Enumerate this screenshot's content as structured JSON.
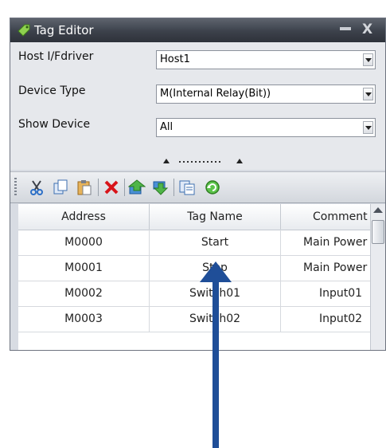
{
  "window": {
    "title": "Tag Editor",
    "minimize_icon": "minimize-icon",
    "close_label": "X"
  },
  "form": {
    "host_label": "Host I/Fdriver",
    "host_value": "Host1",
    "device_type_label": "Device Type",
    "device_type_value": "M(Internal Relay(Bit))",
    "show_device_label": "Show Device",
    "show_device_value": "All"
  },
  "toolbar": {
    "buttons": [
      "cut-icon",
      "copy-icon",
      "paste-icon",
      "delete-icon",
      "move-up-icon",
      "move-down-icon",
      "export-icon",
      "refresh-icon"
    ]
  },
  "grid": {
    "columns": [
      "Address",
      "Tag Name",
      "Comment"
    ],
    "rows": [
      {
        "address": "M0000",
        "tag": "Start",
        "comment": "Main Power"
      },
      {
        "address": "M0001",
        "tag": "Stop",
        "comment": "Main Power"
      },
      {
        "address": "M0002",
        "tag": "Switch01",
        "comment": "Input01"
      },
      {
        "address": "M0003",
        "tag": "Switch02",
        "comment": "Input02"
      }
    ]
  },
  "colors": {
    "title_bar": "#3c414b",
    "annotation_arrow": "#1f4e98",
    "delete_red": "#d8141a",
    "accent_green": "#3aa33a"
  }
}
